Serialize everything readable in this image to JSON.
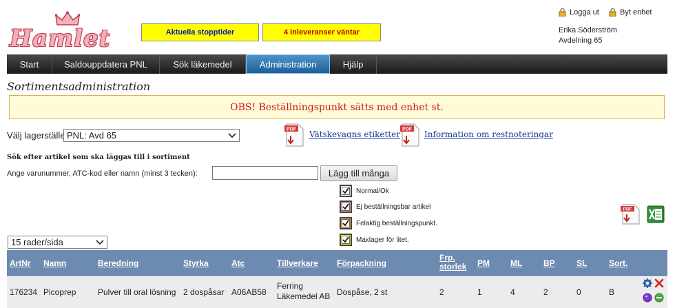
{
  "header": {
    "logo": "Hamlet",
    "notice_stop": "Aktuella stopptider",
    "notice_deliveries": "4 inleveranser väntar",
    "logout": "Logga ut",
    "switch_unit": "Byt enhet",
    "user_name": "Erika Söderström",
    "user_unit": "Avdelning 65"
  },
  "nav": [
    {
      "label": "Start",
      "active": false
    },
    {
      "label": "Saldouppdatera PNL",
      "active": false
    },
    {
      "label": "Sök läkemedel",
      "active": false
    },
    {
      "label": "Administration",
      "active": true
    },
    {
      "label": "Hjälp",
      "active": false
    }
  ],
  "page": {
    "title": "Sortimentsadministration",
    "obs_message": "OBS! Beställningspunkt sätts med enhet st.",
    "storage_label": "Välj lagerställe",
    "storage_value": "PNL: Avd 65",
    "link_labels": "Vätskevagns etiketter",
    "link_restnotes": "Information om restnoteringar",
    "search_heading": "Sök efter artikel som ska läggas till i sortiment",
    "search_label": "Ange varunummer, ATC-kod eller namn (minst 3 tecken):",
    "search_value": "",
    "add_many_button": "Lägg till många",
    "rows_per_page": "15 rader/sida"
  },
  "legend": [
    {
      "label": "Normal/Ok",
      "color": "#ffffff",
      "checked": true
    },
    {
      "label": "Ej beställningsbar artikel",
      "color": "#f4a3a8",
      "checked": true
    },
    {
      "label": "Felaktig beställningspunkt.",
      "color": "#f5a23a",
      "checked": true
    },
    {
      "label": "Maxlager för litet.",
      "color": "#f4f400",
      "checked": true
    }
  ],
  "table": {
    "columns": {
      "artnr": "ArtNr",
      "namn": "Namn",
      "beredning": "Beredning",
      "styrka": "Styrka",
      "atc": "Atc",
      "tillverkare": "Tillverkare",
      "forpackning": "Förpackning",
      "frp_line1": "Frp.",
      "frp_line2": "storlek",
      "pm": "PM",
      "ml": "ML",
      "bp": "BP",
      "sl": "SL",
      "sort": "Sort."
    },
    "rows": [
      {
        "artnr": "176234",
        "namn": "Picoprep",
        "beredning": "Pulver till oral lösning",
        "styrka": "2 dospåsar",
        "atc": "A06AB58",
        "tillverkare_line1": "Ferring",
        "tillverkare_line2": "Läkemedel AB",
        "forpackning": "Dospåse, 2 st",
        "frp": "2",
        "pm": "1",
        "ml": "4",
        "bp": "2",
        "sl": "0",
        "sort": "B"
      }
    ]
  },
  "colors": {
    "accent": "#6d8ab0",
    "nav_active": "#2c73b0",
    "notice": "#ffff00",
    "obs_text": "#c81818"
  }
}
